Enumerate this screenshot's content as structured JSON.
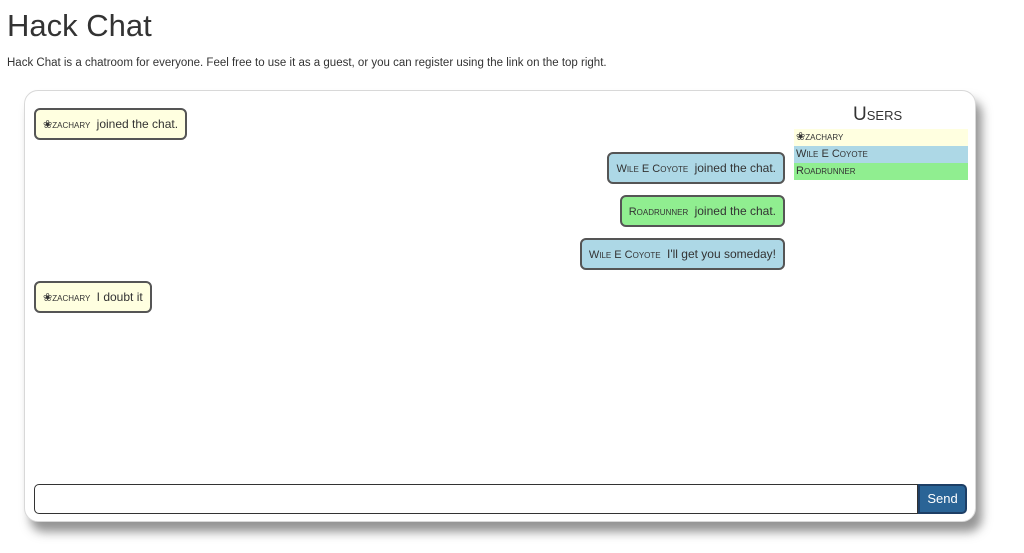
{
  "page": {
    "title": "Hack Chat",
    "description": "Hack Chat is a chatroom for everyone. Feel free to use it as a guest, or you can register using the link on the top right."
  },
  "users_panel": {
    "title": "Users",
    "users": [
      {
        "name": "❀zachary",
        "color": "#ffffe0"
      },
      {
        "name": "Wile E Coyote",
        "color": "#add8e6"
      },
      {
        "name": "Roadrunner",
        "color": "#90ee90"
      }
    ]
  },
  "messages": [
    {
      "nick": "❀zachary",
      "text": "joined the chat.",
      "color": "#ffffe0",
      "align": "left"
    },
    {
      "nick": "Wile E Coyote",
      "text": "joined the chat.",
      "color": "#add8e6",
      "align": "right"
    },
    {
      "nick": "Roadrunner",
      "text": "joined the chat.",
      "color": "#90ee90",
      "align": "right"
    },
    {
      "nick": "Wile E Coyote",
      "text": "I'll get you someday!",
      "color": "#add8e6",
      "align": "right"
    },
    {
      "nick": "❀zachary",
      "text": "I doubt it",
      "color": "#ffffe0",
      "align": "left"
    }
  ],
  "composer": {
    "input_value": "",
    "send_label": "Send"
  }
}
